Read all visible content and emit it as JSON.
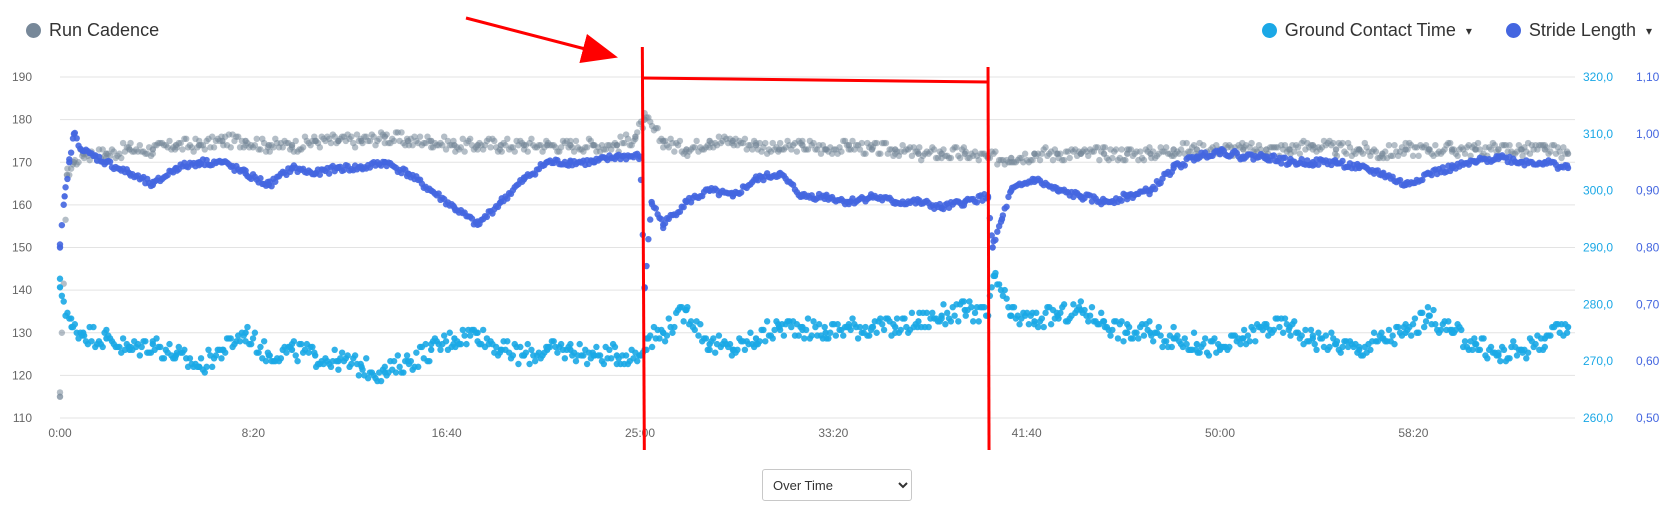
{
  "legend": {
    "left": [
      {
        "label": "Run Cadence",
        "color": "#778899",
        "icon": "legend-dot"
      }
    ],
    "right": [
      {
        "label": "Ground Contact Time",
        "color": "#1ba8e6",
        "icon": "legend-dot",
        "caret": "▾"
      },
      {
        "label": "Stride Length",
        "color": "#4466e0",
        "icon": "legend-dot",
        "caret": "▾"
      }
    ]
  },
  "dropdown": {
    "selected": "Over Time",
    "options": [
      "Over Time"
    ]
  },
  "chart_data": {
    "type": "scatter",
    "x_unit": "minutes",
    "x_ticks": [
      "0:00",
      "8:20",
      "16:40",
      "25:00",
      "33:20",
      "41:40",
      "50:00",
      "58:20"
    ],
    "x_tick_values": [
      0,
      8.333,
      16.667,
      25,
      33.333,
      41.667,
      50,
      58.333
    ],
    "xlim": [
      0,
      65.3
    ],
    "y_left": {
      "ticks": [
        "110",
        "120",
        "130",
        "140",
        "150",
        "160",
        "170",
        "180",
        "190"
      ],
      "ylim": [
        110,
        190
      ]
    },
    "y_right_gct": {
      "ticks": [
        "260,0",
        "270,0",
        "280,0",
        "290,0",
        "300,0",
        "310,0",
        "320,0"
      ],
      "ylim": [
        260,
        320
      ],
      "color": "#1ba8e6"
    },
    "y_right_stride": {
      "ticks": [
        "0,50",
        "0,60",
        "0,70",
        "0,80",
        "0,90",
        "1,00",
        "1,10"
      ],
      "ylim": [
        0.5,
        1.1
      ],
      "color": "#4466e0"
    },
    "grid": true,
    "series": [
      {
        "name": "Run Cadence",
        "axis": "left",
        "color": "#778899",
        "points": [
          [
            0,
            115
          ],
          [
            0.3,
            167
          ],
          [
            0.6,
            170
          ],
          [
            1,
            172
          ],
          [
            2,
            172
          ],
          [
            3,
            173
          ],
          [
            4,
            173
          ],
          [
            5,
            174
          ],
          [
            6,
            174
          ],
          [
            7,
            175
          ],
          [
            8,
            175
          ],
          [
            9,
            174
          ],
          [
            10,
            174
          ],
          [
            11,
            175
          ],
          [
            12,
            175
          ],
          [
            13,
            175
          ],
          [
            14,
            176
          ],
          [
            15,
            175
          ],
          [
            16,
            175
          ],
          [
            17,
            174
          ],
          [
            18,
            174
          ],
          [
            19,
            174
          ],
          [
            20,
            174
          ],
          [
            21,
            174
          ],
          [
            22,
            174
          ],
          [
            23,
            174
          ],
          [
            24,
            174
          ],
          [
            24.8,
            176
          ],
          [
            25.2,
            180
          ],
          [
            26,
            175
          ],
          [
            27,
            173
          ],
          [
            28,
            175
          ],
          [
            29,
            175
          ],
          [
            30,
            174
          ],
          [
            31,
            173
          ],
          [
            32,
            174
          ],
          [
            33,
            173
          ],
          [
            34,
            174
          ],
          [
            35,
            173
          ],
          [
            36,
            173
          ],
          [
            37,
            172
          ],
          [
            38,
            172
          ],
          [
            39,
            172
          ],
          [
            40,
            171
          ],
          [
            41,
            171
          ],
          [
            42,
            172
          ],
          [
            43,
            172
          ],
          [
            44,
            172
          ],
          [
            45,
            172
          ],
          [
            46,
            172
          ],
          [
            47,
            172
          ],
          [
            48,
            173
          ],
          [
            49,
            173
          ],
          [
            50,
            173
          ],
          [
            51,
            173
          ],
          [
            52,
            173
          ],
          [
            53,
            173
          ],
          [
            54,
            174
          ],
          [
            55,
            173
          ],
          [
            56,
            173
          ],
          [
            57,
            172
          ],
          [
            58,
            173
          ],
          [
            59,
            173
          ],
          [
            60,
            173
          ],
          [
            61,
            173
          ],
          [
            62,
            173
          ],
          [
            63,
            173
          ],
          [
            64,
            173
          ],
          [
            65,
            172
          ]
        ]
      },
      {
        "name": "Stride Length",
        "axis": "right_stride",
        "color": "#4466e0",
        "points": [
          [
            0,
            0.8
          ],
          [
            0.2,
            0.89
          ],
          [
            0.4,
            0.95
          ],
          [
            0.6,
            1.0
          ],
          [
            1,
            0.97
          ],
          [
            2,
            0.95
          ],
          [
            3,
            0.93
          ],
          [
            4,
            0.91
          ],
          [
            5,
            0.94
          ],
          [
            6,
            0.95
          ],
          [
            7,
            0.95
          ],
          [
            8,
            0.93
          ],
          [
            9,
            0.91
          ],
          [
            10,
            0.94
          ],
          [
            11,
            0.93
          ],
          [
            12,
            0.94
          ],
          [
            13,
            0.94
          ],
          [
            14,
            0.95
          ],
          [
            15,
            0.93
          ],
          [
            16,
            0.9
          ],
          [
            17,
            0.87
          ],
          [
            18,
            0.84
          ],
          [
            19,
            0.88
          ],
          [
            20,
            0.92
          ],
          [
            21,
            0.95
          ],
          [
            22,
            0.95
          ],
          [
            23,
            0.95
          ],
          [
            24,
            0.96
          ],
          [
            25,
            0.96
          ],
          [
            25.2,
            0.73
          ],
          [
            25.5,
            0.88
          ],
          [
            26,
            0.84
          ],
          [
            27,
            0.88
          ],
          [
            28,
            0.9
          ],
          [
            29,
            0.89
          ],
          [
            30,
            0.92
          ],
          [
            31,
            0.93
          ],
          [
            32,
            0.89
          ],
          [
            33,
            0.89
          ],
          [
            34,
            0.88
          ],
          [
            35,
            0.89
          ],
          [
            36,
            0.88
          ],
          [
            37,
            0.88
          ],
          [
            38,
            0.87
          ],
          [
            39,
            0.88
          ],
          [
            40,
            0.89
          ],
          [
            40.2,
            0.8
          ],
          [
            40.6,
            0.85
          ],
          [
            41,
            0.9
          ],
          [
            42,
            0.92
          ],
          [
            43,
            0.9
          ],
          [
            44,
            0.89
          ],
          [
            45,
            0.88
          ],
          [
            46,
            0.89
          ],
          [
            47,
            0.9
          ],
          [
            48,
            0.94
          ],
          [
            49,
            0.96
          ],
          [
            50,
            0.97
          ],
          [
            51,
            0.96
          ],
          [
            52,
            0.96
          ],
          [
            53,
            0.95
          ],
          [
            54,
            0.95
          ],
          [
            55,
            0.95
          ],
          [
            56,
            0.94
          ],
          [
            57,
            0.93
          ],
          [
            58,
            0.91
          ],
          [
            59,
            0.93
          ],
          [
            60,
            0.94
          ],
          [
            61,
            0.95
          ],
          [
            62,
            0.96
          ],
          [
            63,
            0.95
          ],
          [
            64,
            0.95
          ],
          [
            65,
            0.94
          ]
        ]
      },
      {
        "name": "Ground Contact Time",
        "axis": "right_gct",
        "color": "#1ba8e6",
        "points": [
          [
            0,
            283
          ],
          [
            0.5,
            276
          ],
          [
            1,
            275
          ],
          [
            2,
            274
          ],
          [
            3,
            272
          ],
          [
            4,
            273
          ],
          [
            5,
            271
          ],
          [
            6,
            269
          ],
          [
            7,
            272
          ],
          [
            8,
            275
          ],
          [
            9,
            271
          ],
          [
            10,
            272
          ],
          [
            11,
            271
          ],
          [
            12,
            270
          ],
          [
            13,
            269
          ],
          [
            14,
            268
          ],
          [
            15,
            270
          ],
          [
            16,
            272
          ],
          [
            17,
            274
          ],
          [
            18,
            275
          ],
          [
            19,
            272
          ],
          [
            20,
            271
          ],
          [
            21,
            272
          ],
          [
            22,
            272
          ],
          [
            23,
            271
          ],
          [
            24,
            271
          ],
          [
            25,
            271
          ],
          [
            25.3,
            274
          ],
          [
            26,
            275
          ],
          [
            27,
            279
          ],
          [
            28,
            273
          ],
          [
            29,
            272
          ],
          [
            30,
            274
          ],
          [
            31,
            276
          ],
          [
            32,
            276
          ],
          [
            33,
            275
          ],
          [
            34,
            276
          ],
          [
            35,
            276
          ],
          [
            36,
            276
          ],
          [
            37,
            277
          ],
          [
            38,
            278
          ],
          [
            39,
            279
          ],
          [
            40,
            278
          ],
          [
            40.3,
            285
          ],
          [
            41,
            278
          ],
          [
            42,
            277
          ],
          [
            43,
            278
          ],
          [
            44,
            279
          ],
          [
            45,
            277
          ],
          [
            46,
            275
          ],
          [
            47,
            275
          ],
          [
            48,
            274
          ],
          [
            49,
            273
          ],
          [
            50,
            272
          ],
          [
            51,
            274
          ],
          [
            52,
            276
          ],
          [
            53,
            276
          ],
          [
            54,
            274
          ],
          [
            55,
            273
          ],
          [
            56,
            272
          ],
          [
            57,
            274
          ],
          [
            58,
            275
          ],
          [
            59,
            278
          ],
          [
            60,
            275
          ],
          [
            61,
            273
          ],
          [
            62,
            271
          ],
          [
            63,
            272
          ],
          [
            64,
            274
          ],
          [
            65,
            276
          ]
        ]
      }
    ],
    "annotations": [
      {
        "type": "arrow",
        "from": [
          17.5,
          "top"
        ],
        "to": [
          23.8,
          "top"
        ],
        "color": "#ff0000"
      },
      {
        "type": "vline",
        "x": 25.1,
        "color": "#ff0000"
      },
      {
        "type": "vline",
        "x": 40.0,
        "color": "#ff0000"
      },
      {
        "type": "hline",
        "x_from": 25.1,
        "x_to": 40.0,
        "color": "#ff0000"
      }
    ]
  }
}
